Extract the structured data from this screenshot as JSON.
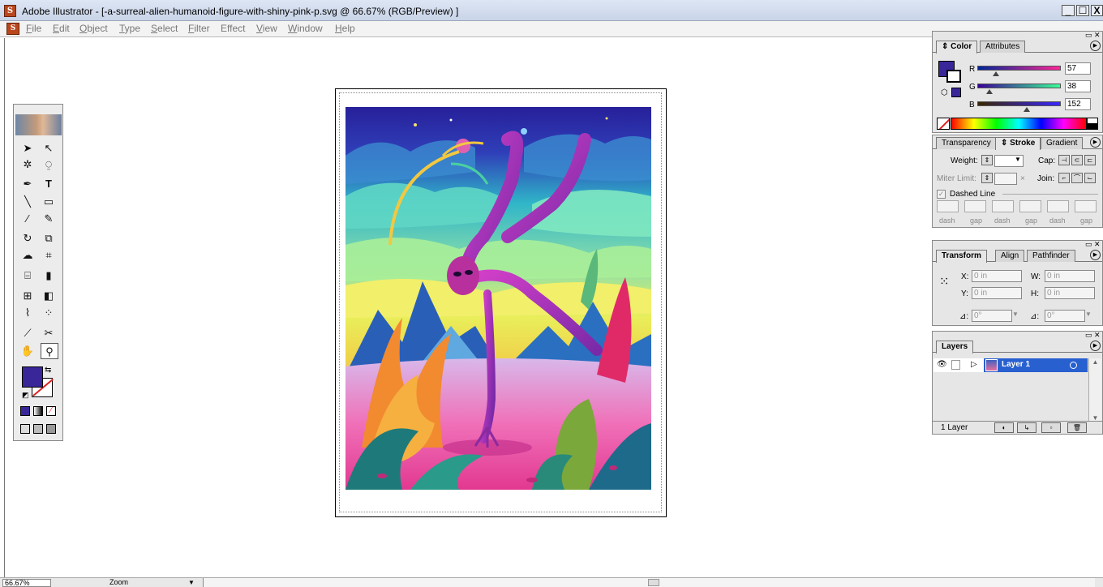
{
  "window": {
    "title": "Adobe Illustrator - [-a-surreal-alien-humanoid-figure-with-shiny-pink-p.svg @ 66.67% (RGB/Preview) ]",
    "minimize": "_",
    "maximize": "☐",
    "close": "X"
  },
  "menu": {
    "items": [
      {
        "label": "File",
        "key": "F",
        "rest": "ile"
      },
      {
        "label": "Edit",
        "key": "E",
        "rest": "dit"
      },
      {
        "label": "Object",
        "key": "O",
        "rest": "bject"
      },
      {
        "label": "Type",
        "key": "T",
        "rest": "ype"
      },
      {
        "label": "Select",
        "key": "S",
        "rest": "elect"
      },
      {
        "label": "Filter",
        "key": "F",
        "rest": "ilter"
      },
      {
        "label": "Effect",
        "key": "",
        "rest": "Effect"
      },
      {
        "label": "View",
        "key": "V",
        "rest": "iew"
      },
      {
        "label": "Window",
        "key": "W",
        "rest": "indow"
      },
      {
        "label": "Help",
        "key": "H",
        "rest": "elp"
      }
    ]
  },
  "toolbox": {
    "fill_color": "#392698",
    "stroke": "none"
  },
  "color_panel": {
    "tabs": [
      "Color",
      "Attributes"
    ],
    "active_tab": "Color",
    "r_label": "R",
    "g_label": "G",
    "b_label": "B",
    "r": "57",
    "g": "38",
    "b": "152",
    "r_fraction": 0.224,
    "g_fraction": 0.149,
    "b_fraction": 0.596,
    "swatch": "#392698"
  },
  "stroke_panel": {
    "tabs": [
      "Transparency",
      "Stroke",
      "Gradient"
    ],
    "active_tab": "Stroke",
    "weight_label": "Weight:",
    "cap_label": "Cap:",
    "miter_label": "Miter Limit:",
    "miter_x": "×",
    "join_label": "Join:",
    "dashed_label": "Dashed Line",
    "dash_labels": [
      "dash",
      "gap",
      "dash",
      "gap",
      "dash",
      "gap"
    ]
  },
  "transform_panel": {
    "tabs": [
      "Transform",
      "Align",
      "Pathfinder"
    ],
    "active_tab": "Transform",
    "x_label": "X:",
    "y_label": "Y:",
    "w_label": "W:",
    "h_label": "H:",
    "x": "0 in",
    "y": "0 in",
    "w": "0 in",
    "h": "0 in",
    "rotate_label": "⊿:",
    "shear_label": "⊿:",
    "rotate": "0°",
    "shear": "0°"
  },
  "layers_panel": {
    "tab": "Layers",
    "layer_name": "Layer 1",
    "count": "1 Layer"
  },
  "status": {
    "zoom": "66.67%",
    "tool": "Zoom"
  }
}
